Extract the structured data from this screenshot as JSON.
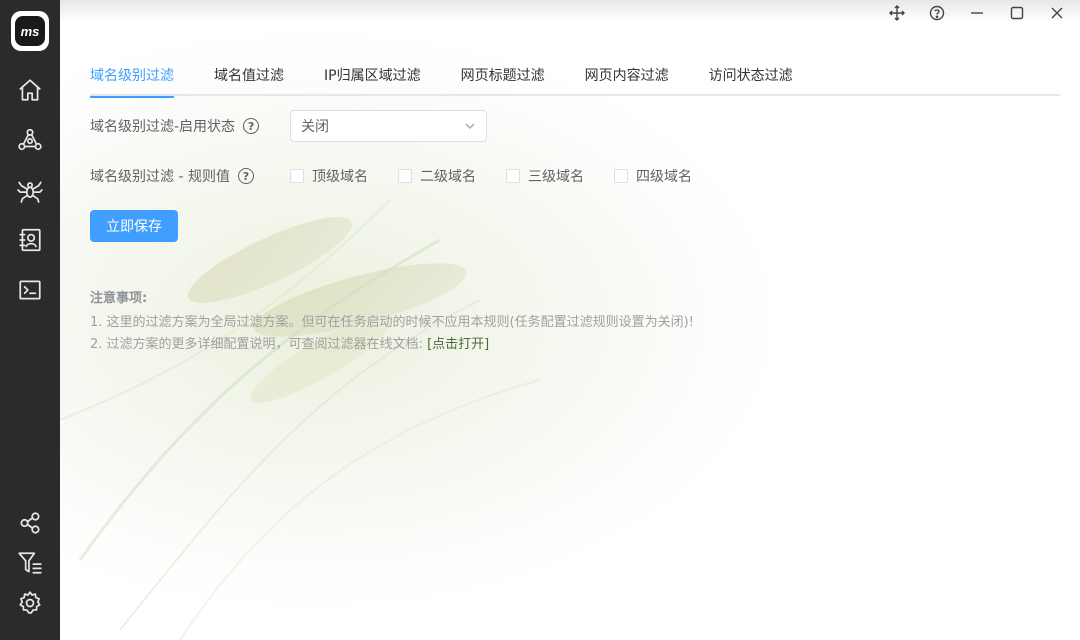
{
  "logo": {
    "text": "ms"
  },
  "sidebar": {
    "top_icons": [
      "home-icon",
      "network-icon",
      "spider-icon",
      "contacts-icon",
      "terminal-icon"
    ],
    "bottom_icons": [
      "share-icon",
      "filter-icon",
      "settings-icon"
    ]
  },
  "window": {
    "controls": [
      "move-icon",
      "help-icon",
      "minimize-icon",
      "maximize-icon",
      "close-icon"
    ]
  },
  "tabs": [
    {
      "label": "域名级别过滤",
      "active": true
    },
    {
      "label": "域名值过滤"
    },
    {
      "label": "IP归属区域过滤"
    },
    {
      "label": "网页标题过滤"
    },
    {
      "label": "网页内容过滤"
    },
    {
      "label": "访问状态过滤"
    }
  ],
  "form": {
    "enable_label": "域名级别过滤-启用状态",
    "enable_value": "关闭",
    "rule_label": "域名级别过滤 - 规则值",
    "help_glyph": "?",
    "options": [
      {
        "label": "顶级域名",
        "checked": false
      },
      {
        "label": "二级域名",
        "checked": false
      },
      {
        "label": "三级域名",
        "checked": false
      },
      {
        "label": "四级域名",
        "checked": false
      }
    ],
    "save_label": "立即保存"
  },
  "notes": {
    "title": "注意事项:",
    "line1": "1. 这里的过滤方案为全局过滤方案。但可在任务启动的时候不应用本规则(任务配置过滤规则设置为关闭)!",
    "line2_prefix": "2. 过滤方案的更多详细配置说明，可查阅过滤器在线文档: ",
    "line2_link": "[点击打开]"
  },
  "colors": {
    "accent": "#409eff",
    "sidebar": "#2b2b2b"
  }
}
